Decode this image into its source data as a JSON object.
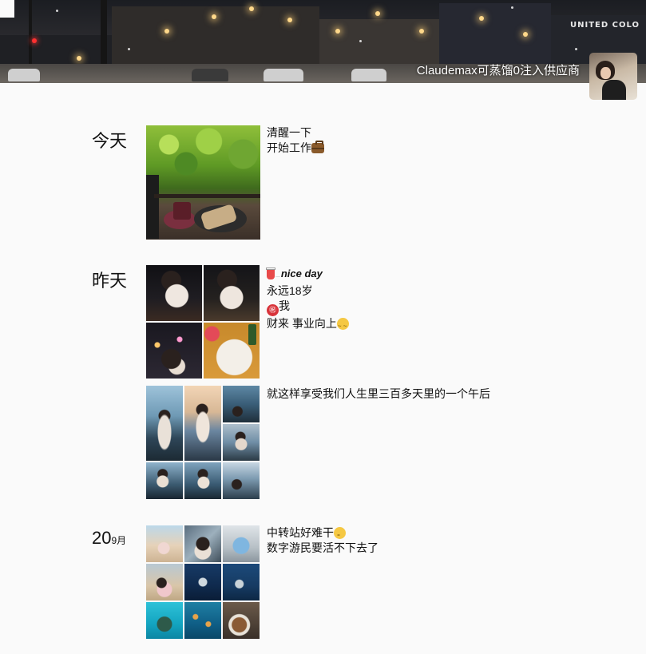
{
  "profile": {
    "nickname": "Claudemax可蒸馏0注入供应商",
    "cover_sign": "UNITED COLO",
    "cover_icon": "city-night-street",
    "avatar_icon": "avatar-photo"
  },
  "posts": [
    {
      "day_label": "今天",
      "caption_lines": [
        "清醒一下",
        "开始工作"
      ],
      "caption_emoji": "briefcase-emoji",
      "photos": [
        "forest-coffee-photo"
      ]
    },
    {
      "day_label": "昨天",
      "caption_lines": [
        "nice day",
        "永远18岁",
        "我",
        "财来 事业向上"
      ],
      "caption_prefix": "...",
      "caption_emojis": [
        "drink-cup-emoji",
        "red-seal-emoji",
        "eye-roll-emoji"
      ],
      "photos": [
        "portrait-night-1",
        "portrait-night-2",
        "portrait-night-3",
        "food-table-photo"
      ]
    },
    {
      "day_label": "",
      "caption_lines": [
        "就这样享受我们人生里三百多天里的一个午后"
      ],
      "photos": [
        "beach-1",
        "beach-2",
        "beach-3",
        "beach-4",
        "beach-5",
        "beach-6",
        "beach-7",
        "beach-8"
      ]
    },
    {
      "day_label": "20",
      "month_label": "9月",
      "caption_lines": [
        "中转站好难干",
        "数字游民要活不下去了"
      ],
      "caption_emoji": "thinking-face-emoji",
      "photos": [
        "shore-1",
        "shore-2",
        "shore-3",
        "shore-4",
        "dive-1",
        "dive-2",
        "sea-1",
        "sea-2",
        "table-photo"
      ]
    }
  ],
  "colors": {
    "background": "#fafafa",
    "text": "#111111",
    "nickname": "#ffffff"
  }
}
